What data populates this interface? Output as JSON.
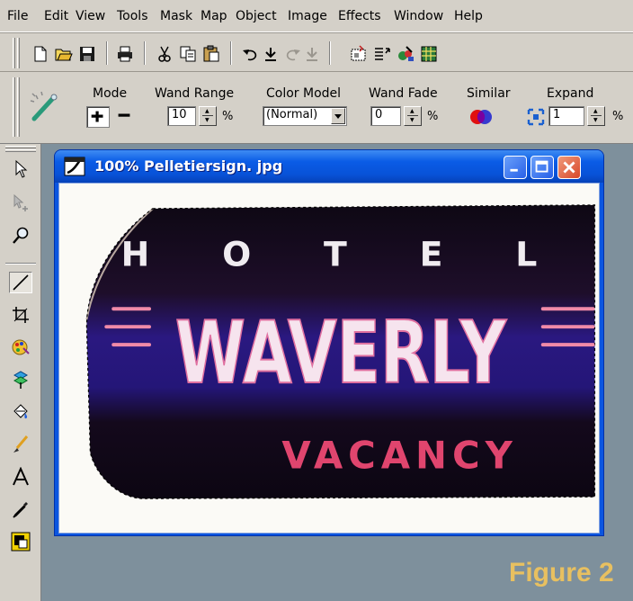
{
  "menu": [
    "File",
    "Edit",
    "View",
    "Tools",
    "Mask",
    "Map",
    "Object",
    "Image",
    "Effects",
    "Window",
    "Help"
  ],
  "toolbar": {
    "icons": [
      "new-icon",
      "open-icon",
      "save-icon",
      "print-icon",
      "cut-icon",
      "copy-icon",
      "paste-icon",
      "undo-icon",
      "undo-history-icon",
      "redo-icon",
      "redo-history-icon",
      "crop-selection-icon",
      "layer-list-icon",
      "color-picker-icon",
      "grid-icon"
    ]
  },
  "options": {
    "tool_icon": "magic-wand-icon",
    "mode_label": "Mode",
    "wand_range_label": "Wand Range",
    "wand_range_value": "10",
    "color_model_label": "Color Model",
    "color_model_value": "(Normal)",
    "wand_fade_label": "Wand Fade",
    "wand_fade_value": "0",
    "similar_label": "Similar",
    "expand_label": "Expand",
    "expand_value": "1",
    "percent": "%"
  },
  "palette": {
    "tools": [
      "arrow-pointer-icon",
      "move-icon",
      "zoom-icon",
      "line-icon",
      "crop-icon",
      "color-replacer-icon",
      "clone-icon",
      "paint-bucket-icon",
      "brush-icon",
      "text-icon",
      "eyedropper-icon",
      "color-swatch-icon"
    ]
  },
  "document": {
    "title": "100% Pelletiersign. jpg",
    "sign": {
      "top_text": "H O T E L",
      "main_text": "WAVERLY",
      "bottom_text": "VACANCY"
    }
  },
  "figure_label": "Figure 2",
  "colors": {
    "sign_dark": "#1a0d24",
    "sign_band": "#2c1a8c",
    "sign_pink": "#e04a7a",
    "figure_label": "#e8c060"
  }
}
